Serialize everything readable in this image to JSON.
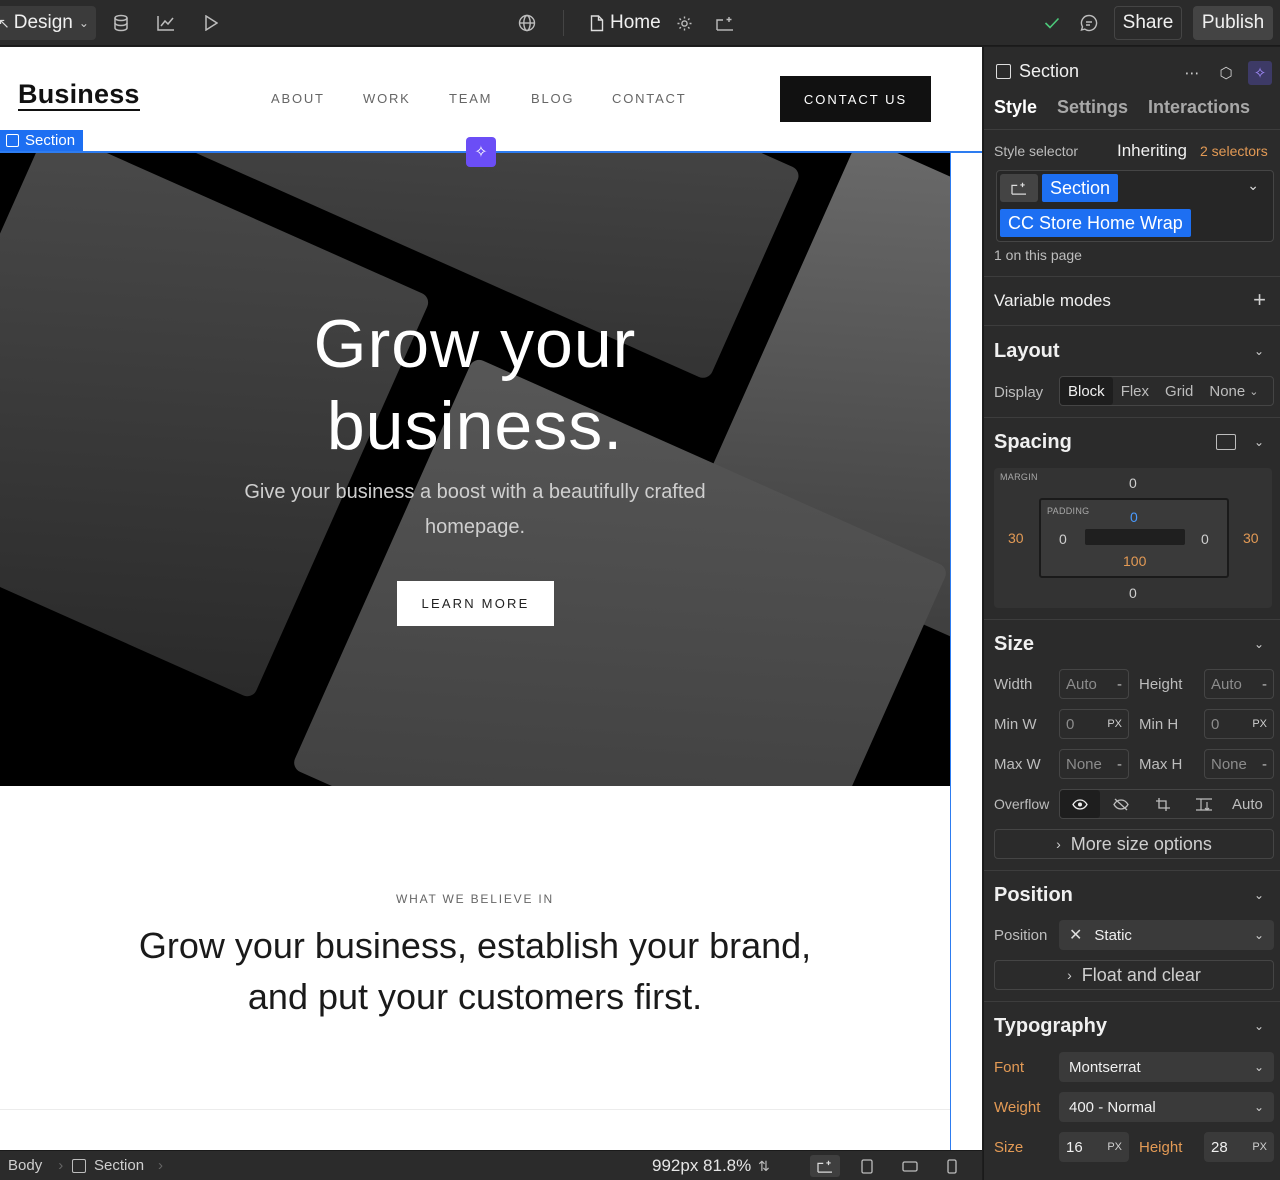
{
  "topbar": {
    "mode_label": "Design",
    "page_name": "Home",
    "share_label": "Share",
    "publish_label": "Publish"
  },
  "site": {
    "logo": "Business",
    "nav": [
      "ABOUT",
      "WORK",
      "TEAM",
      "BLOG",
      "CONTACT"
    ],
    "cta": "CONTACT US",
    "hero_title_line1": "Grow your",
    "hero_title_line2": "business.",
    "hero_sub_line1": "Give your business a boost with a beautifully crafted",
    "hero_sub_line2": "homepage.",
    "hero_button": "LEARN MORE",
    "eyebrow": "WHAT WE BELIEVE IN",
    "statement_line1": "Grow your business, establish your brand,",
    "statement_line2": "and put your customers first."
  },
  "canvas": {
    "selected_tag": "Section"
  },
  "status": {
    "crumb_body": "Body",
    "crumb_section": "Section",
    "viewport": "992px 81.8%"
  },
  "panel": {
    "element_name": "Section",
    "tabs": [
      "Style",
      "Settings",
      "Interactions"
    ],
    "style_selector_label": "Style selector",
    "inheriting_label": "Inheriting",
    "inheriting_count": "2 selectors",
    "chip_primary": "Section",
    "chip_secondary": "CC Store Home Wrap",
    "on_page": "1 on this page",
    "variable_modes": "Variable modes",
    "layout": {
      "title": "Layout",
      "display_label": "Display",
      "options": [
        "Block",
        "Flex",
        "Grid",
        "None"
      ],
      "selected": "Block"
    },
    "spacing": {
      "title": "Spacing",
      "margin_label": "MARGIN",
      "padding_label": "PADDING",
      "margin_top": "0",
      "margin_left": "30",
      "margin_right": "30",
      "margin_bottom": "0",
      "padding_top": "0",
      "padding_left": "0",
      "padding_right": "0",
      "padding_bottom": "100"
    },
    "size": {
      "title": "Size",
      "width_label": "Width",
      "width_value": "Auto",
      "height_label": "Height",
      "height_value": "Auto",
      "minw_label": "Min W",
      "minw_value": "0",
      "minw_unit": "PX",
      "minh_label": "Min H",
      "minh_value": "0",
      "minh_unit": "PX",
      "maxw_label": "Max W",
      "maxw_value": "None",
      "maxh_label": "Max H",
      "maxh_value": "None",
      "overflow_label": "Overflow",
      "overflow_auto": "Auto",
      "more_label": "More size options"
    },
    "position": {
      "title": "Position",
      "label": "Position",
      "value": "Static",
      "float_label": "Float and clear"
    },
    "typography": {
      "title": "Typography",
      "font_label": "Font",
      "font_value": "Montserrat",
      "weight_label": "Weight",
      "weight_value": "400 - Normal",
      "size_label": "Size",
      "size_value": "16",
      "size_unit": "PX",
      "height_label": "Height",
      "height_value": "28",
      "height_unit": "PX"
    }
  },
  "colors": {
    "accent_blue": "#1d6ff2",
    "ai_purple": "#6b4ef6",
    "inherited_orange": "#e39a55",
    "padding_blue": "#4a9bff"
  }
}
